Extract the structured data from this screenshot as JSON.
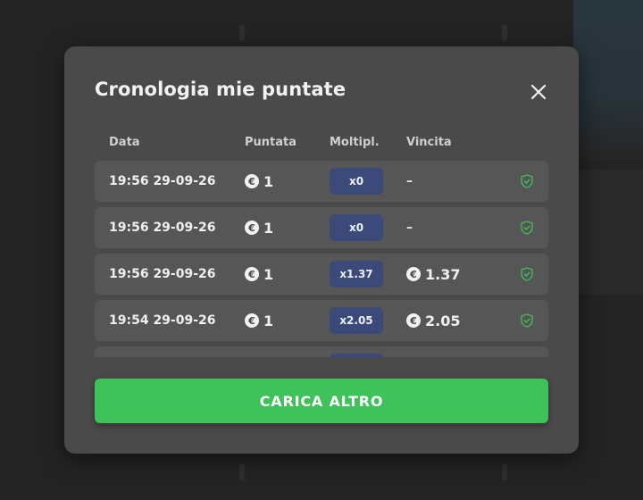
{
  "modal": {
    "title": "Cronologia mie puntate",
    "columns": {
      "date": "Data",
      "bet": "Puntata",
      "multiplier": "Moltipl.",
      "win": "Vincita"
    },
    "rows": [
      {
        "date": "19:56 29-09-26",
        "bet": "1",
        "multiplier": "x0",
        "win": "–",
        "win_has_coin": false
      },
      {
        "date": "19:56 29-09-26",
        "bet": "1",
        "multiplier": "x0",
        "win": "–",
        "win_has_coin": false
      },
      {
        "date": "19:56 29-09-26",
        "bet": "1",
        "multiplier": "x1.37",
        "win": "1.37",
        "win_has_coin": true
      },
      {
        "date": "19:54 29-09-26",
        "bet": "1",
        "multiplier": "x2.05",
        "win": "2.05",
        "win_has_coin": true
      }
    ],
    "load_more_label": "CARICA ALTRO",
    "currency_symbol": "€"
  },
  "colors": {
    "accent_green": "#3fc25a",
    "badge_blue": "#3b4a78",
    "shield_green": "#3fbf58",
    "row_bg": "#565656",
    "modal_bg": "#4a4a4a"
  },
  "icons": {
    "close": "close-icon",
    "coin": "euro-coin-icon",
    "shield": "shield-check-icon"
  }
}
